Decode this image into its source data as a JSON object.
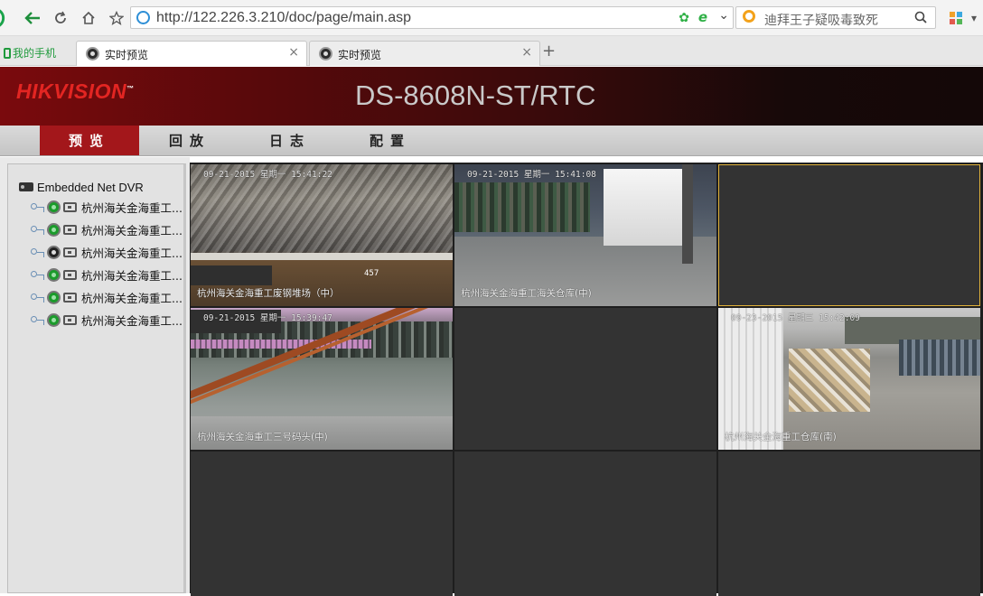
{
  "browser": {
    "url": "http://122.226.3.210/doc/page/main.asp",
    "search_placeholder": "迪拜王子疑吸毒致死",
    "mobile_label": "我的手机",
    "tabs": [
      {
        "label": "实时预览",
        "active": true
      },
      {
        "label": "实时预览",
        "active": false
      }
    ],
    "close_glyph": "×",
    "new_tab_glyph": "+"
  },
  "app": {
    "brand": "HIKVISION",
    "model": "DS-8608N-ST/RTC",
    "menu": [
      {
        "label": "预览",
        "active": true
      },
      {
        "label": "回放",
        "active": false
      },
      {
        "label": "日志",
        "active": false
      },
      {
        "label": "配置",
        "active": false
      }
    ]
  },
  "device_tree": {
    "root": "Embedded Net DVR",
    "channels": [
      {
        "label": "杭州海关金海重工...",
        "status": "live"
      },
      {
        "label": "杭州海关金海重工...",
        "status": "live"
      },
      {
        "label": "杭州海关金海重工...",
        "status": "idle"
      },
      {
        "label": "杭州海关金海重工...",
        "status": "live"
      },
      {
        "label": "杭州海关金海重工...",
        "status": "live"
      },
      {
        "label": "杭州海关金海重工...",
        "status": "live"
      }
    ]
  },
  "video": {
    "cells": [
      {
        "name": "杭州海关金海重工废钢堆场（中）",
        "time": "09-21-2015 星期一 15:41:22",
        "extra": "457"
      },
      {
        "name": "杭州海关金海重工海关仓库(中)",
        "time": "09-21-2015 星期一 15:41:08"
      },
      {
        "name": "",
        "time": "",
        "selected": true
      },
      {
        "name": "杭州海关金海重工三号码头(中)",
        "time": "09-21-2015 星期一 15:39:47"
      },
      {
        "name": "",
        "time": ""
      },
      {
        "name": "杭州海关金海重工仓库(南)",
        "time": "09-23-2015 星期三 15:42:09"
      },
      {
        "name": "",
        "time": ""
      },
      {
        "name": "",
        "time": ""
      },
      {
        "name": "",
        "time": ""
      }
    ]
  }
}
